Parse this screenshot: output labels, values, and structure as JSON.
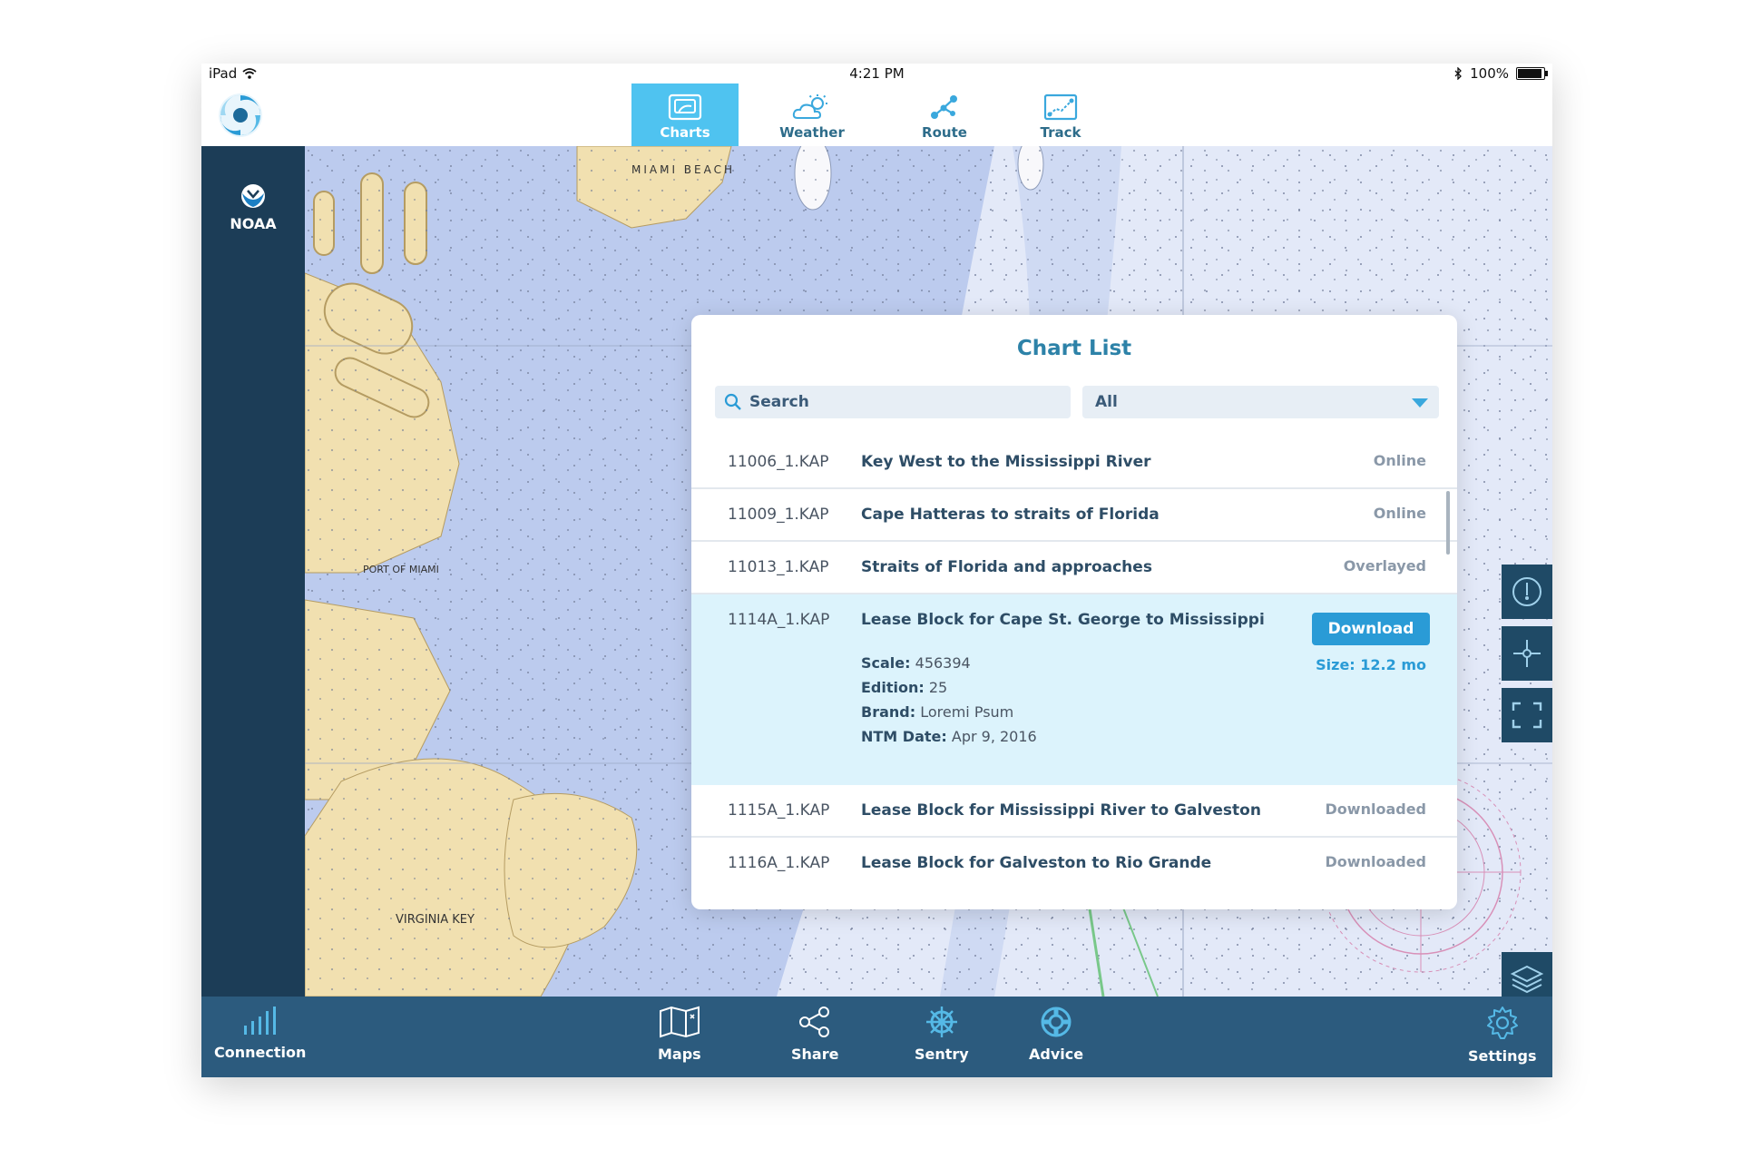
{
  "statusbar": {
    "device": "iPad",
    "time": "4:21 PM",
    "battery": "100%",
    "battery_fraction": 1.0
  },
  "tabs": [
    {
      "label": "Charts",
      "icon": "chart-icon",
      "active": true
    },
    {
      "label": "Weather",
      "icon": "weather-icon",
      "active": false
    },
    {
      "label": "Route",
      "icon": "route-icon",
      "active": false
    },
    {
      "label": "Track",
      "icon": "track-icon",
      "active": false
    }
  ],
  "sidebar": {
    "brand": "NOAA"
  },
  "panel": {
    "title": "Chart List",
    "search_placeholder": "Search",
    "filter_value": "All",
    "rows": [
      {
        "file": "11006_1.KAP",
        "name": "Key West to the Mississippi River",
        "status": "Online"
      },
      {
        "file": "11009_1.KAP",
        "name": "Cape Hatteras to straits of Florida",
        "status": "Online"
      },
      {
        "file": "11013_1.KAP",
        "name": "Straits of Florida and approaches",
        "status": "Overlayed"
      },
      {
        "file": "1114A_1.KAP",
        "name": "Lease Block for Cape St. George to Mississippi",
        "button": "Download",
        "size_label": "Size:",
        "size_value": "12.2 mo",
        "details": [
          {
            "label": "Scale:",
            "value": "456394"
          },
          {
            "label": "Edition:",
            "value": "25"
          },
          {
            "label": "Brand:",
            "value": "Loremi Psum"
          },
          {
            "label": "NTM Date:",
            "value": "Apr 9, 2016"
          }
        ]
      },
      {
        "file": "1115A_1.KAP",
        "name": "Lease Block for Mississippi River to Galveston",
        "status": "Downloaded"
      },
      {
        "file": "1116A_1.KAP",
        "name": "Lease Block for Galveston to Rio Grande",
        "status": "Downloaded"
      }
    ]
  },
  "map_labels": {
    "port": "PORT OF MIAMI",
    "key": "VIRGINIA KEY",
    "beach": "MIAMI BEACH"
  },
  "bottombar": {
    "connection": "Connection",
    "maps": "Maps",
    "share": "Share",
    "sentry": "Sentry",
    "advice": "Advice",
    "settings": "Settings"
  },
  "colors": {
    "accent": "#4fc3f0",
    "sidebar": "#1c3d57",
    "bottombar": "#2c5b7e",
    "button": "#2a9bd6"
  }
}
